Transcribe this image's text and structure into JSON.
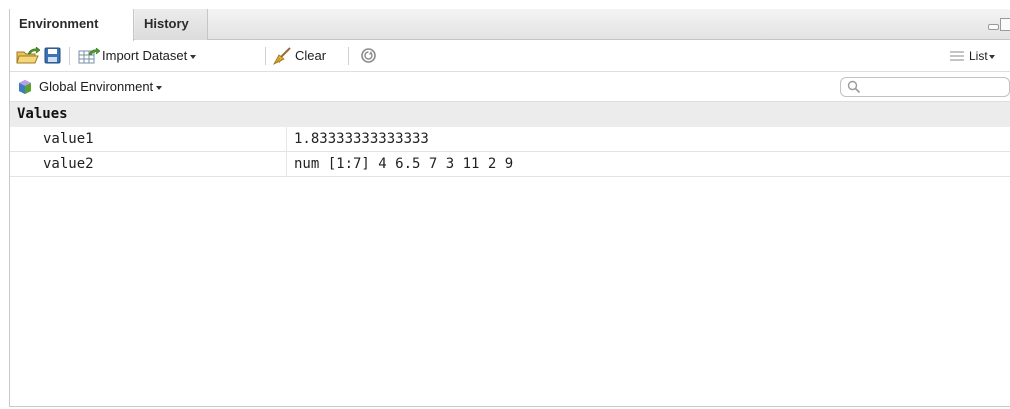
{
  "tabs": [
    {
      "label": "Environment",
      "active": true
    },
    {
      "label": "History",
      "active": false
    }
  ],
  "toolbar": {
    "load_icon": "open-folder-arrow-icon",
    "save_icon": "floppy-disk-icon",
    "import_label": "Import Dataset",
    "import_icon": "table-import-icon",
    "clear_label": "Clear",
    "clear_icon": "broom-icon",
    "refresh_icon": "refresh-icon",
    "view_label": "List",
    "view_icon": "list-lines-icon"
  },
  "env": {
    "selected": "Global Environment",
    "icon": "r-environment-cube-icon",
    "search_placeholder": ""
  },
  "section": {
    "title": "Values"
  },
  "variables": [
    {
      "name": "value1",
      "value": "1.83333333333333"
    },
    {
      "name": "value2",
      "value": "num [1:7] 4 6.5 7 3 11 2 9"
    }
  ],
  "colors": {
    "section_bg": "#ececec",
    "tab_bg": "#e3e3e3",
    "accent_green": "#5aa02c",
    "save_blue": "#3a73b8"
  }
}
